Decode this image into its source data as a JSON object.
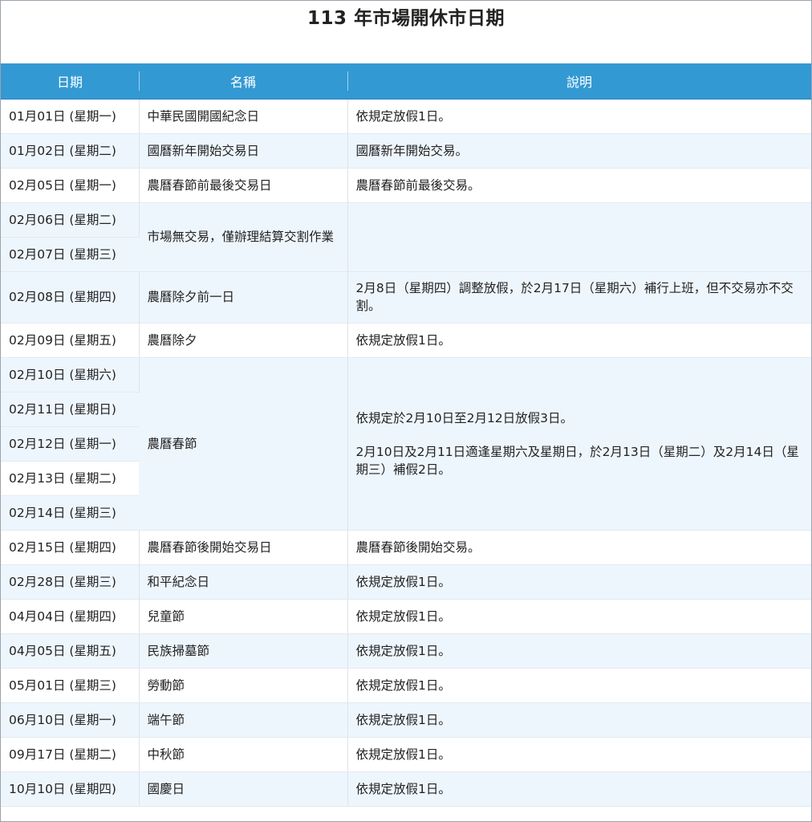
{
  "title": "113 年市場開休市日期",
  "headers": {
    "date": "日期",
    "name": "名稱",
    "desc": "說明"
  },
  "rows": [
    {
      "date": "01月01日 (星期一)",
      "name": "中華民國開國紀念日",
      "desc": "依規定放假1日。"
    },
    {
      "date": "01月02日 (星期二)",
      "name": "國曆新年開始交易日",
      "desc": "國曆新年開始交易。"
    },
    {
      "date": "02月05日 (星期一)",
      "name": "農曆春節前最後交易日",
      "desc": "農曆春節前最後交易。"
    },
    {
      "date": "02月06日 (星期二)",
      "name": "市場無交易，僅辦理結算交割作業",
      "desc": ""
    },
    {
      "date": "02月07日 (星期三)"
    },
    {
      "date": "02月08日 (星期四)",
      "name": "農曆除夕前一日",
      "desc": "2月8日（星期四）調整放假，於2月17日（星期六）補行上班，但不交易亦不交割。"
    },
    {
      "date": "02月09日 (星期五)",
      "name": "農曆除夕",
      "desc": "依規定放假1日。"
    },
    {
      "date": "02月10日 (星期六)",
      "name": "農曆春節",
      "desc": "依規定於2月10日至2月12日放假3日。",
      "desc2": "2月10日及2月11日適逢星期六及星期日，於2月13日（星期二）及2月14日（星期三）補假2日。"
    },
    {
      "date": "02月11日 (星期日)"
    },
    {
      "date": "02月12日 (星期一)"
    },
    {
      "date": "02月13日 (星期二)"
    },
    {
      "date": "02月14日 (星期三)"
    },
    {
      "date": "02月15日 (星期四)",
      "name": "農曆春節後開始交易日",
      "desc": "農曆春節後開始交易。"
    },
    {
      "date": "02月28日 (星期三)",
      "name": "和平紀念日",
      "desc": "依規定放假1日。"
    },
    {
      "date": "04月04日 (星期四)",
      "name": "兒童節",
      "desc": "依規定放假1日。"
    },
    {
      "date": "04月05日 (星期五)",
      "name": "民族掃墓節",
      "desc": "依規定放假1日。"
    },
    {
      "date": "05月01日 (星期三)",
      "name": "勞動節",
      "desc": "依規定放假1日。"
    },
    {
      "date": "06月10日 (星期一)",
      "name": "端午節",
      "desc": "依規定放假1日。"
    },
    {
      "date": "09月17日 (星期二)",
      "name": "中秋節",
      "desc": "依規定放假1日。"
    },
    {
      "date": "10月10日 (星期四)",
      "name": "國慶日",
      "desc": "依規定放假1日。"
    }
  ],
  "colors": {
    "header_bg": "#3399d3",
    "row_alt_bg": "#eef6fd",
    "header_text": "#ffffff"
  }
}
